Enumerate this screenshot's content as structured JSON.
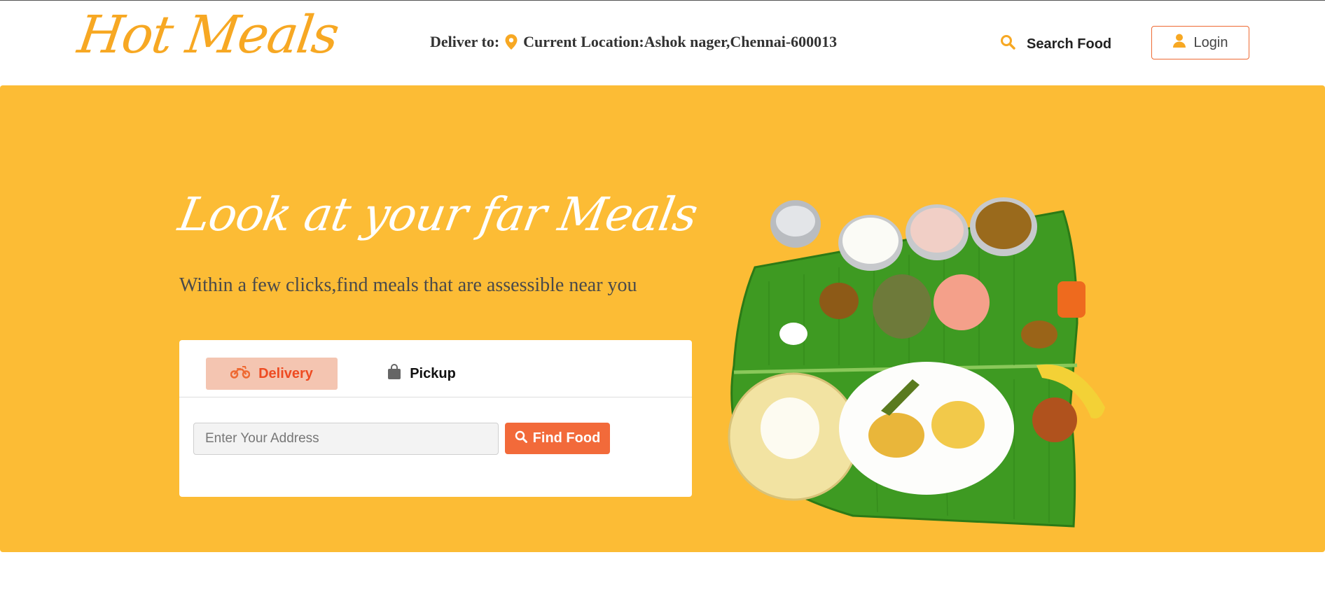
{
  "header": {
    "logo": "Hot Meals",
    "deliver_label": "Deliver to:",
    "location_text": "Current Location:Ashok nager,Chennai-600013",
    "search_label": "Search Food",
    "login_label": "Login"
  },
  "hero": {
    "title": "Look at your far Meals",
    "subtitle": "Within a few clicks,find meals that are assessible near you",
    "tabs": [
      {
        "label": "Delivery",
        "icon": "motorcycle-icon",
        "active": true
      },
      {
        "label": "Pickup",
        "icon": "shopping-bag-icon",
        "active": false
      }
    ],
    "address_placeholder": "Enter Your Address",
    "find_button": "Find Food"
  },
  "colors": {
    "brand": "#f7a823",
    "hero_bg": "#fcbc35",
    "accent": "#f26a3a",
    "tab_active_bg": "#f4c5b1"
  }
}
